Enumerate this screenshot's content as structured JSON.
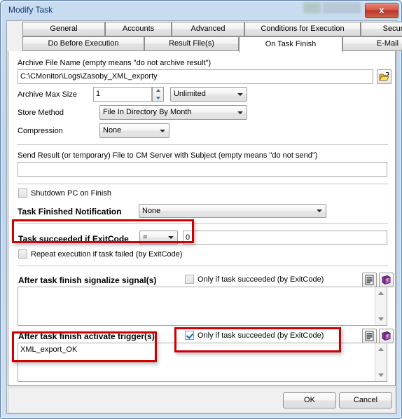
{
  "window": {
    "title": "Modify Task",
    "close_label": "x"
  },
  "tabs": {
    "row1": [
      {
        "label": "General",
        "active": false
      },
      {
        "label": "Accounts",
        "active": false
      },
      {
        "label": "Advanced",
        "active": false
      },
      {
        "label": "Conditions for Execution",
        "active": false
      },
      {
        "label": "Security",
        "active": false
      }
    ],
    "row2": [
      {
        "label": "Do Before Execution",
        "active": false
      },
      {
        "label": "Result File(s)",
        "active": false
      },
      {
        "label": "On Task Finish",
        "active": true
      },
      {
        "label": "E-Mail",
        "active": false
      }
    ]
  },
  "form": {
    "archive_file_name_label": "Archive File Name (empty means \"do not archive result\")",
    "archive_file_name_value": "C:\\CMonitor\\Logs\\Zasoby_XML_exporty",
    "browse_icon": "open-folder-icon",
    "archive_max_size_label": "Archive Max Size",
    "archive_max_size_value": "1",
    "archive_max_size_unit": "Unlimited",
    "store_method_label": "Store Method",
    "store_method_value": "File In Directory By Month",
    "compression_label": "Compression",
    "compression_value": "None",
    "send_result_label": "Send Result (or temporary) File to CM Server with Subject (empty means \"do not send\")",
    "send_result_value": "",
    "shutdown_label": "Shutdown PC on Finish",
    "shutdown_checked": false,
    "notification_label": "Task Finished Notification",
    "notification_value": "None",
    "exitcode_label": "Task succeeded if ExitCode",
    "exitcode_operator": "=",
    "exitcode_value": "0",
    "repeat_label": "Repeat execution if task failed (by ExitCode)",
    "repeat_checked": false,
    "signals_label": "After task finish signalize signal(s)",
    "signals_only_if_label": "Only if task succeeded (by ExitCode)",
    "signals_only_if_checked": false,
    "signals_value": "",
    "triggers_label": "After task finish activate trigger(s)",
    "triggers_only_if_label": "Only if task succeeded (by ExitCode)",
    "triggers_only_if_checked": true,
    "triggers_value": "XML_export_OK",
    "list_icon": "list-document-icon",
    "book_icon": "purple-book-icon"
  },
  "footer": {
    "ok_label": "OK",
    "cancel_label": "Cancel"
  },
  "colors": {
    "annotation": "#cc0000",
    "title_text": "#13386a",
    "close_button": "#b93526"
  }
}
